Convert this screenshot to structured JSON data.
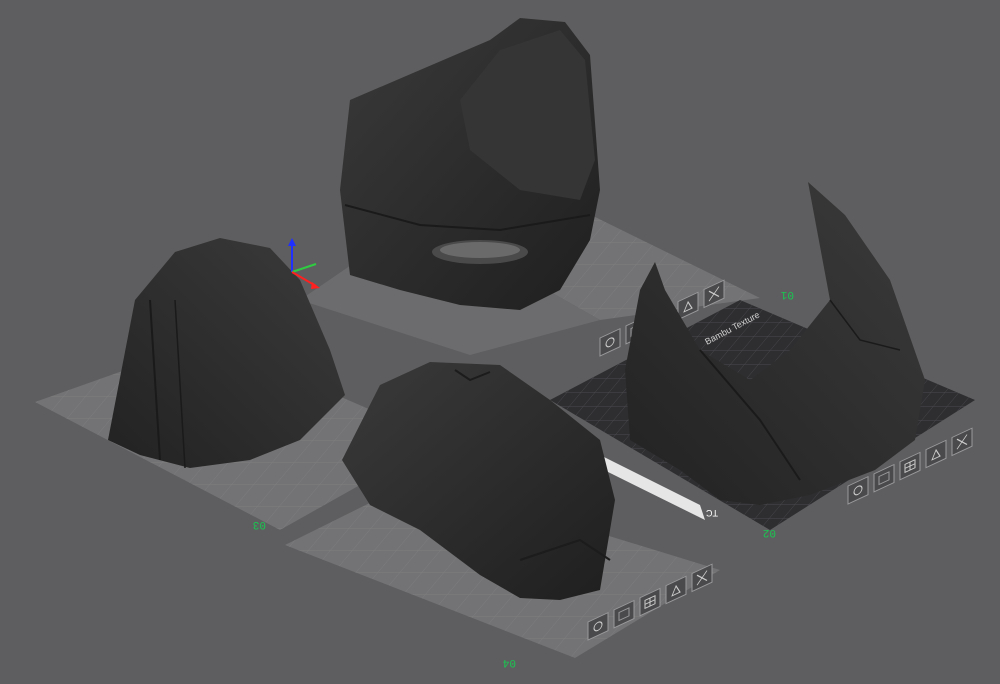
{
  "viewport": {
    "background_color": "#5e5e60",
    "plate_color": "#737375",
    "textured_plate_color": "#2e2e31",
    "plate_label_color": "#19c850",
    "model_color": "#2b2b2b"
  },
  "plates": [
    {
      "label": "01",
      "tool_buttons": [
        "camera-icon",
        "photo-icon",
        "grid-icon",
        "move-icon",
        "close-icon"
      ]
    },
    {
      "label": "02",
      "tool_buttons": [
        "camera-icon",
        "photo-icon",
        "grid-icon",
        "move-icon",
        "close-icon"
      ],
      "texture_name": "Bambu Texture"
    },
    {
      "label": "03",
      "tool_buttons": []
    },
    {
      "label": "04",
      "tool_buttons": [
        "camera-icon",
        "photo-icon",
        "grid-icon",
        "move-icon",
        "close-icon"
      ]
    }
  ],
  "plate02_badge": "TC"
}
